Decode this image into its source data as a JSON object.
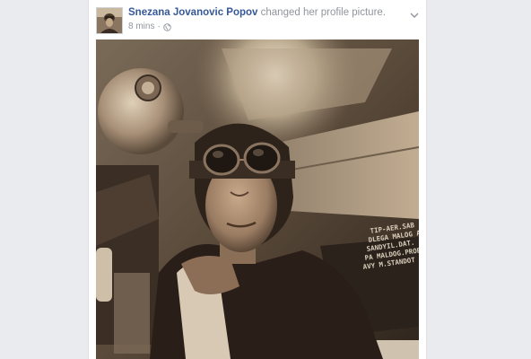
{
  "post": {
    "author": "Snezana Jovanovic Popov",
    "action": " changed her profile picture.",
    "timestamp": "8 mins",
    "separator": "·",
    "privacy_icon": "globe-icon",
    "options_icon": "chevron-down-icon"
  },
  "photo": {
    "plane_lettering": [
      "TIP-AER.SAB",
      "DLEGA MALOG A",
      "SANDYIL.DAT.",
      "PA MALDOG.PROB",
      "AVY M.STANDOT"
    ]
  },
  "colors": {
    "link": "#365899",
    "meta": "#90949c",
    "background": "#e9ebee",
    "card": "#ffffff"
  }
}
